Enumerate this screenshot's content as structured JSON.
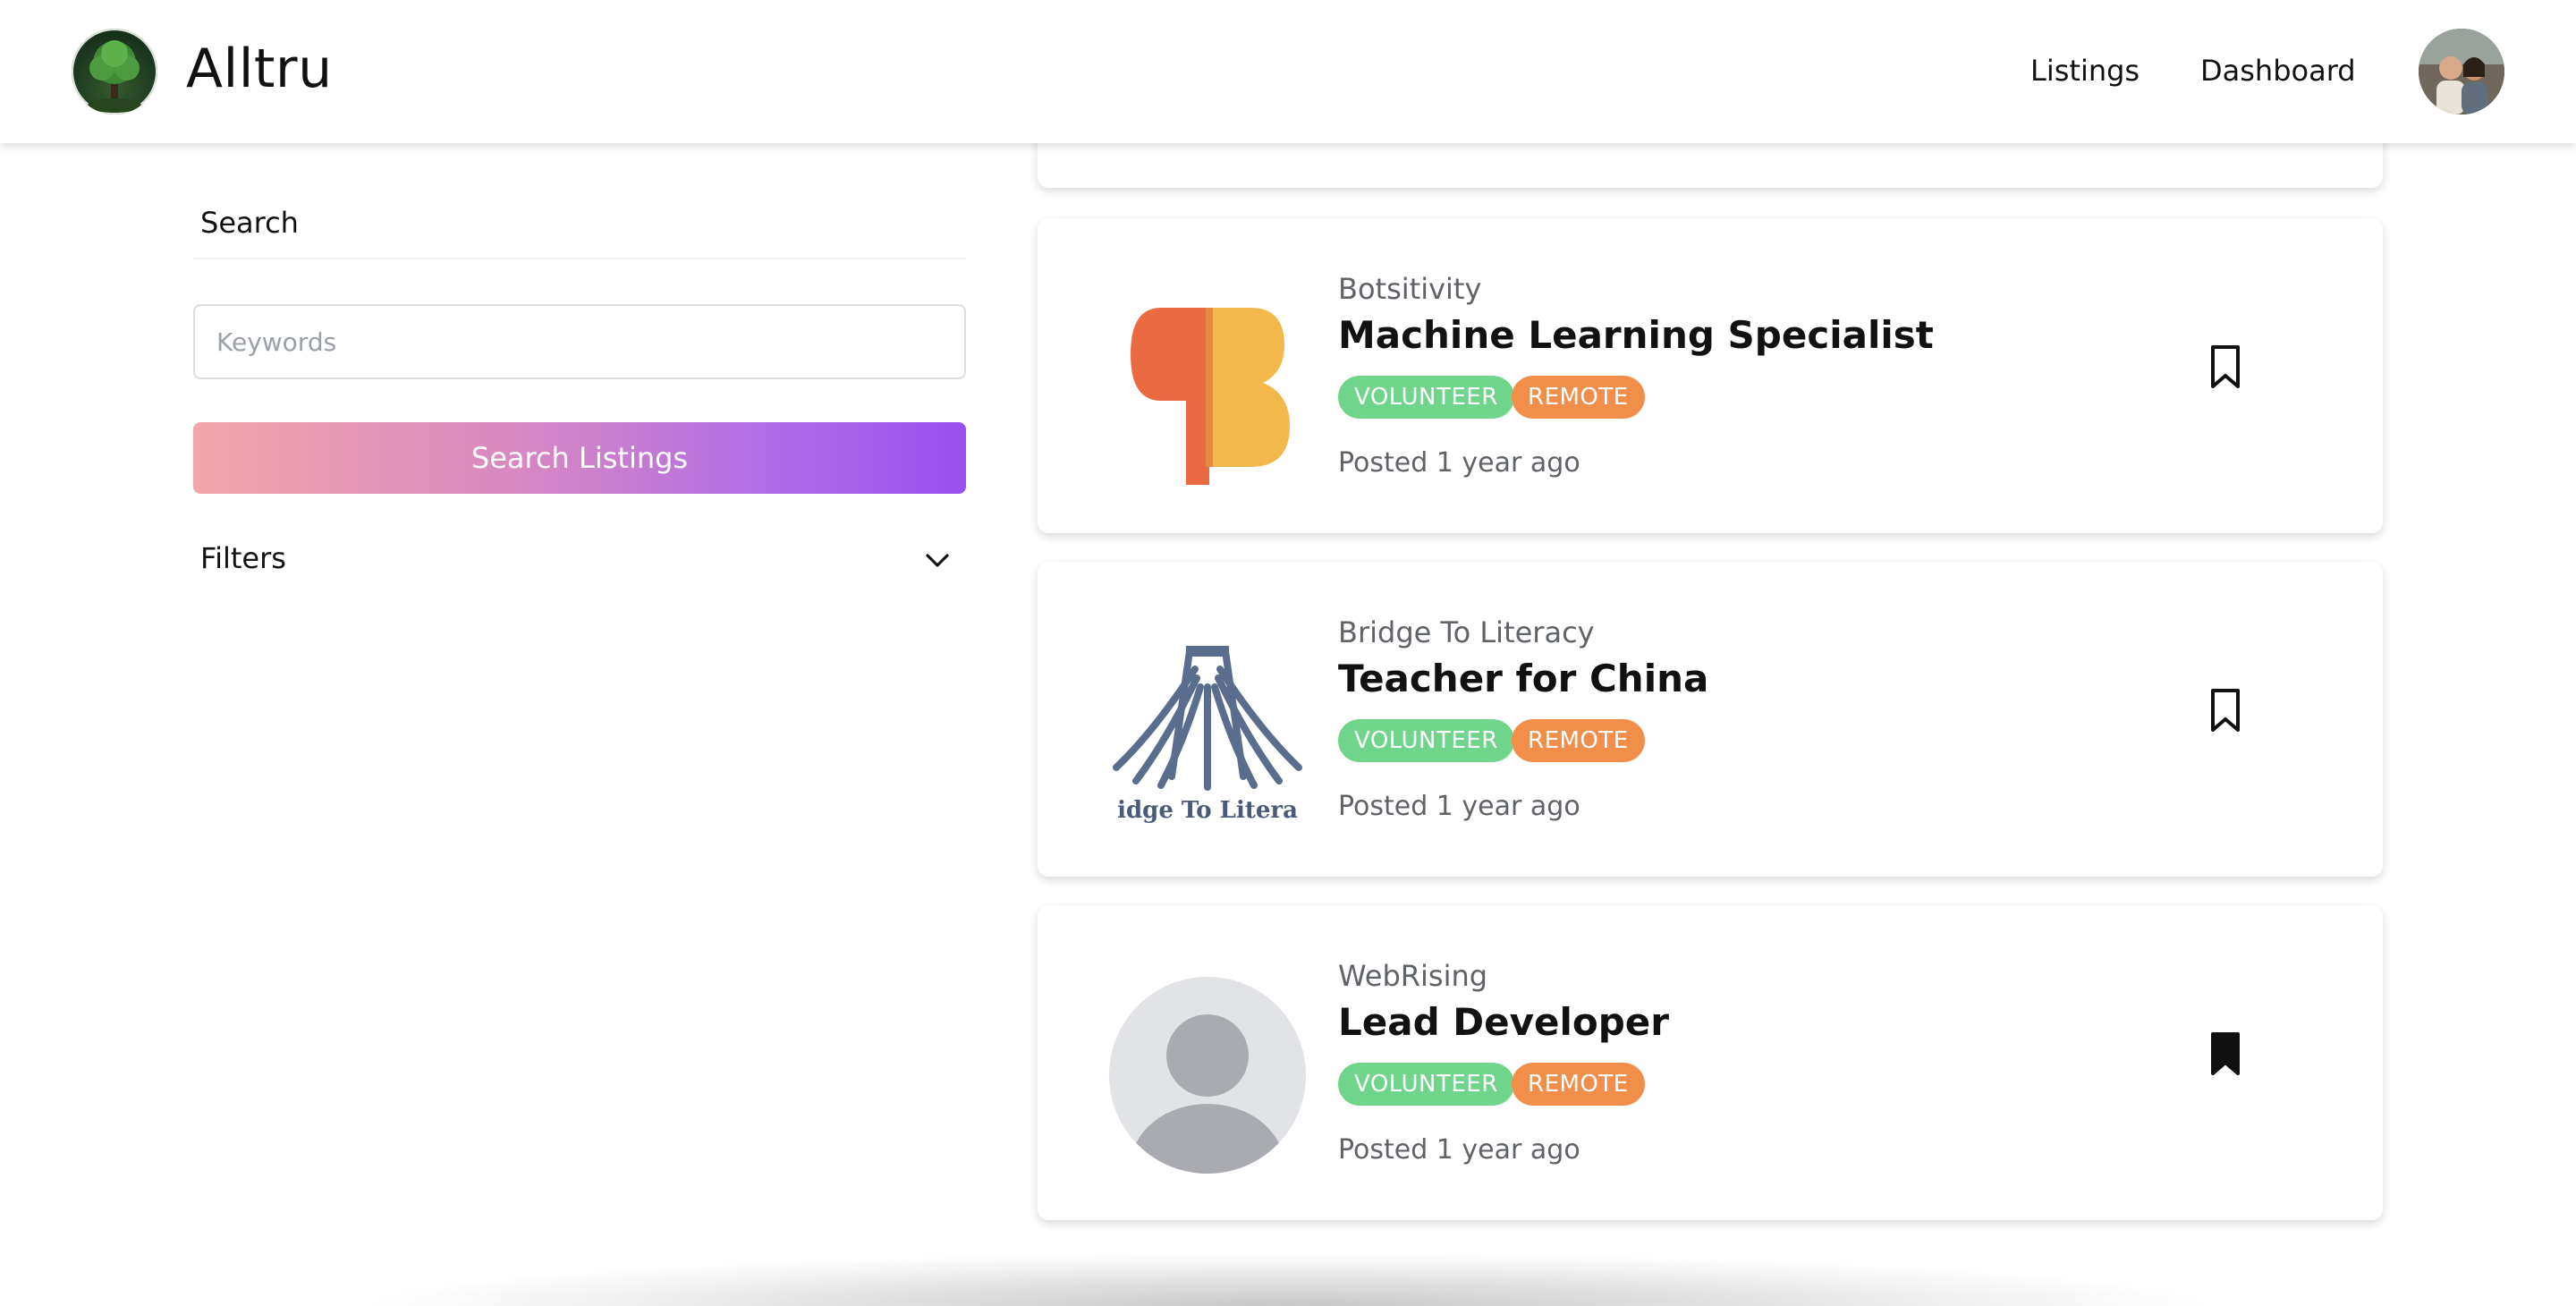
{
  "header": {
    "brand": "Alltru",
    "nav": [
      {
        "label": "Listings"
      },
      {
        "label": "Dashboard"
      }
    ]
  },
  "sidebar": {
    "search_heading": "Search",
    "keywords_placeholder": "Keywords",
    "keywords_value": "",
    "search_button": "Search Listings",
    "filters_label": "Filters"
  },
  "listings": [
    {
      "org": "Botsitivity",
      "title": "Machine Learning Specialist",
      "tags": [
        "VOLUNTEER",
        "REMOTE"
      ],
      "posted": "Posted 1 year ago",
      "bookmarked": false
    },
    {
      "org": "Bridge To Literacy",
      "logo_text": "idge To Litera",
      "title": "Teacher for China",
      "tags": [
        "VOLUNTEER",
        "REMOTE"
      ],
      "posted": "Posted 1 year ago",
      "bookmarked": false
    },
    {
      "org": "WebRising",
      "title": "Lead Developer",
      "tags": [
        "VOLUNTEER",
        "REMOTE"
      ],
      "posted": "Posted 1 year ago",
      "bookmarked": true
    }
  ],
  "colors": {
    "volunteer_tag": "#6fd58a",
    "remote_tag": "#f08e4a",
    "button_gradient_start": "#f2a6aa",
    "button_gradient_end": "#9a4ff0"
  }
}
